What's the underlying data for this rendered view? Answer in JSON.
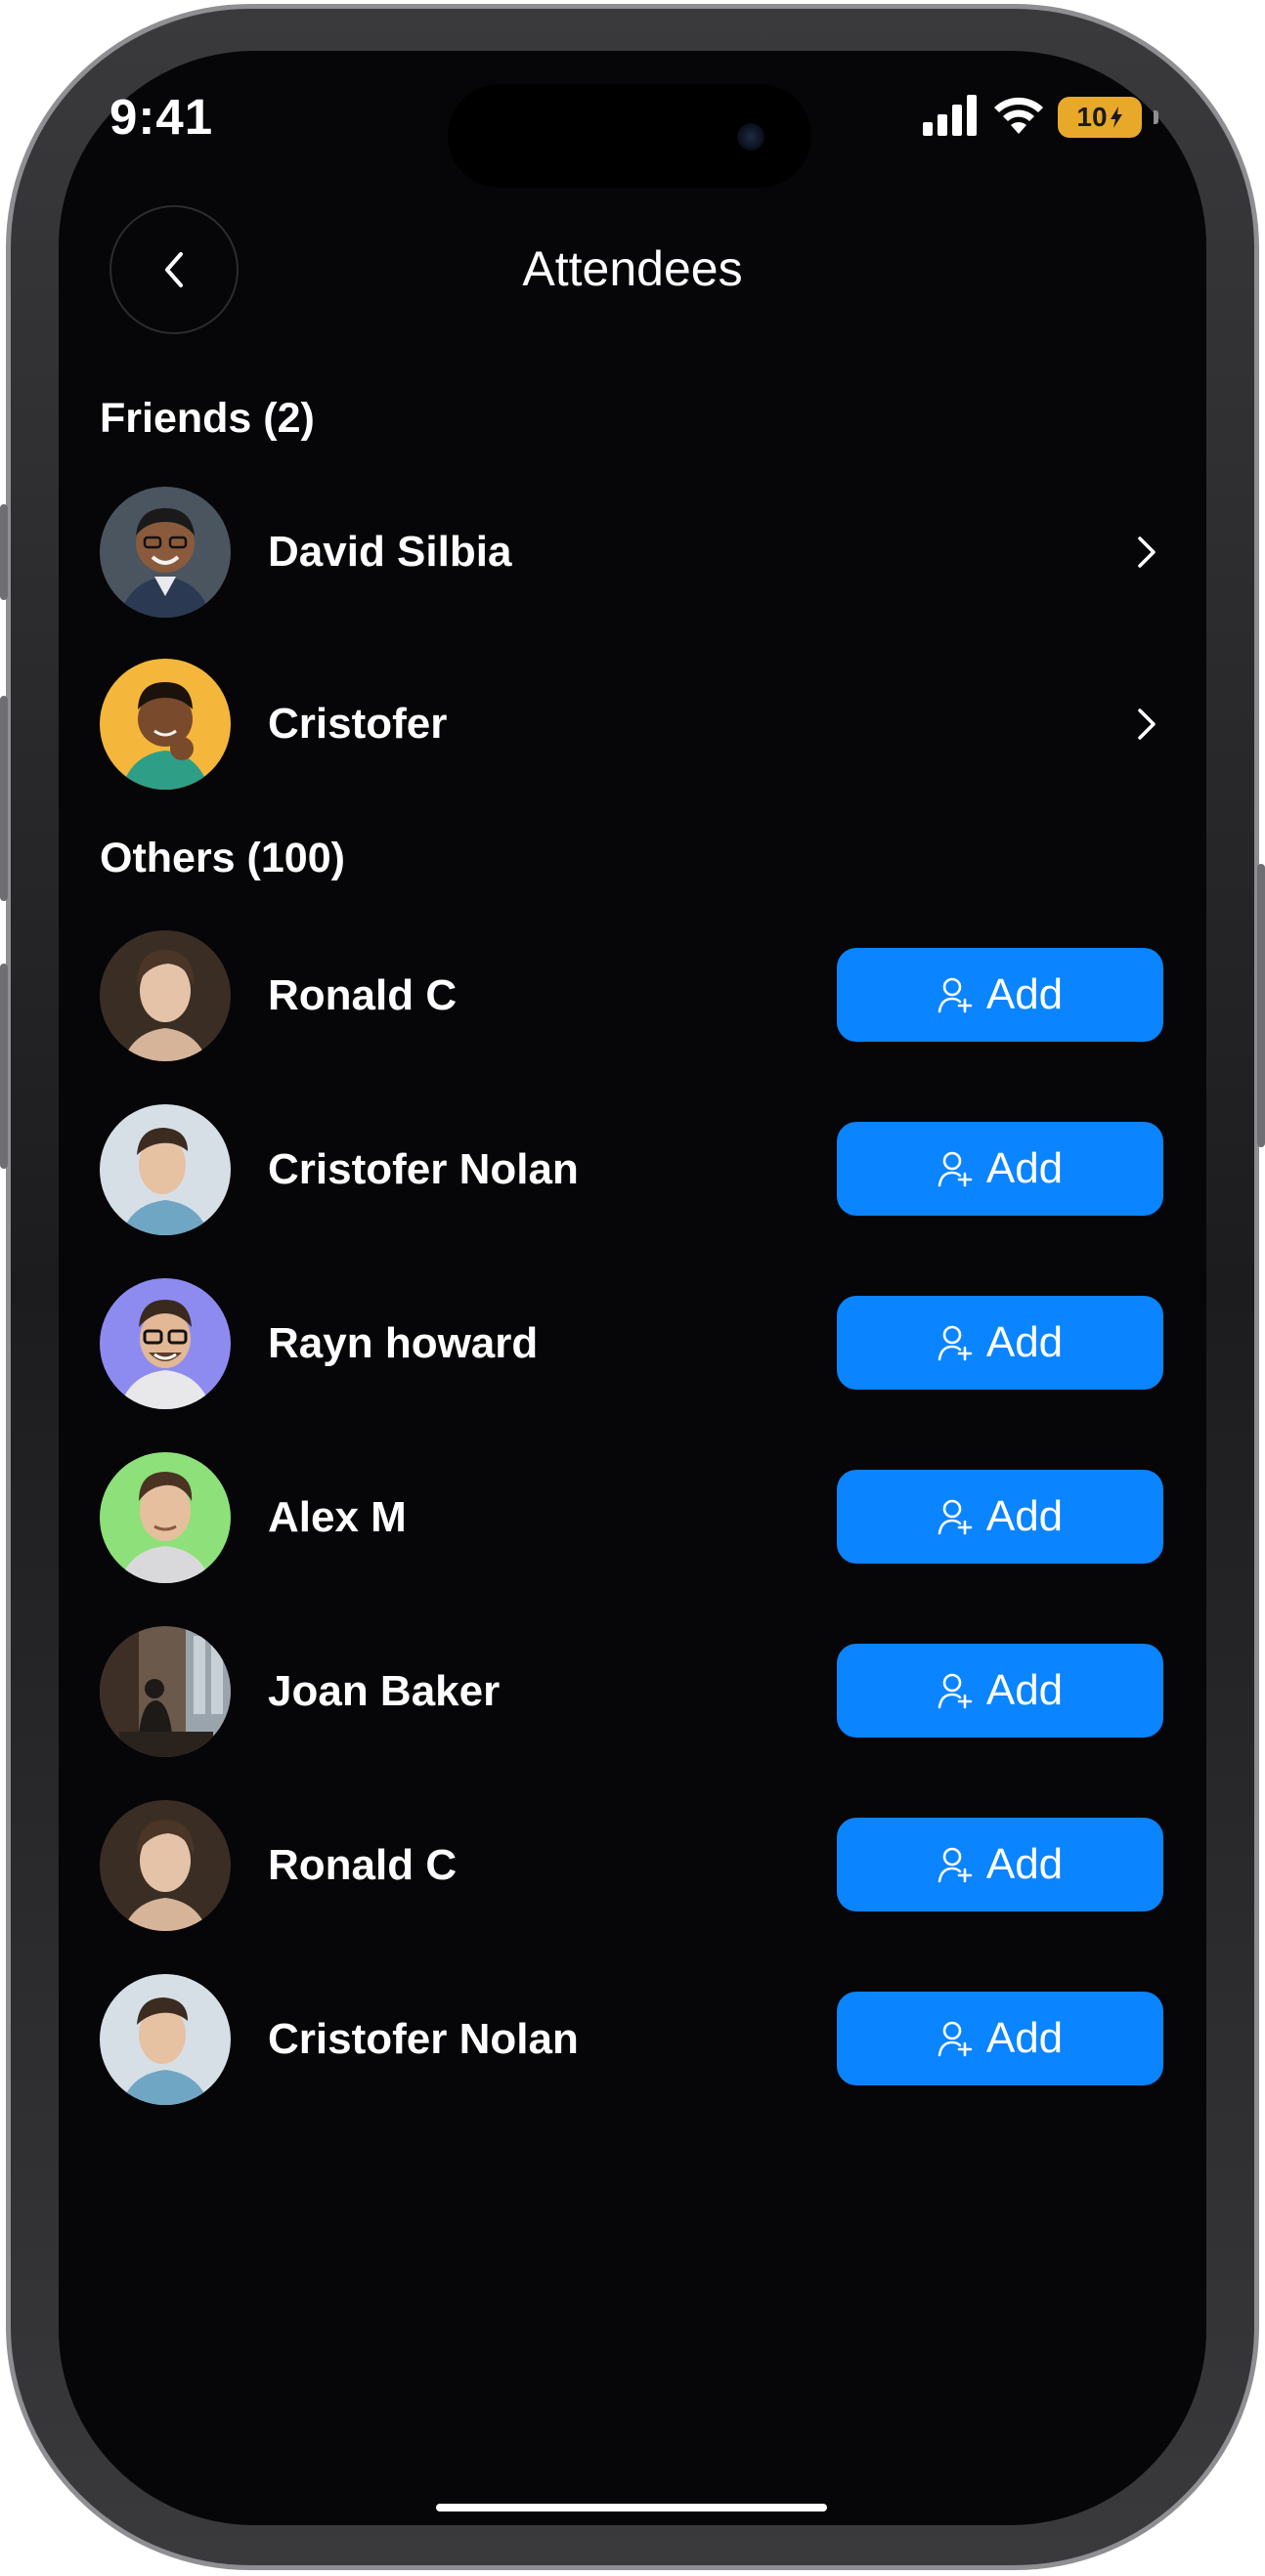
{
  "status_bar": {
    "time": "9:41",
    "battery_level": "10"
  },
  "header": {
    "title": "Attendees"
  },
  "friends": {
    "heading": "Friends (2)",
    "items": [
      {
        "name": "David Silbia",
        "avatar_bg": "#4a5560"
      },
      {
        "name": "Cristofer",
        "avatar_bg": "#f4b73b"
      }
    ]
  },
  "others": {
    "heading": "Others (100)",
    "add_label": "Add",
    "items": [
      {
        "name": "Ronald C",
        "avatar_bg": "#3a2e24"
      },
      {
        "name": "Cristofer Nolan",
        "avatar_bg": "#d7dfe6"
      },
      {
        "name": "Rayn howard",
        "avatar_bg": "#8e8bf0"
      },
      {
        "name": "Alex M",
        "avatar_bg": "#8ee07a"
      },
      {
        "name": "Joan Baker",
        "avatar_bg": "#6b5a4c"
      },
      {
        "name": "Ronald C",
        "avatar_bg": "#3a2e24"
      },
      {
        "name": "Cristofer Nolan",
        "avatar_bg": "#d7dfe6"
      }
    ]
  },
  "colors": {
    "accent": "#0a84ff",
    "background": "#060608",
    "text": "#ffffff"
  }
}
